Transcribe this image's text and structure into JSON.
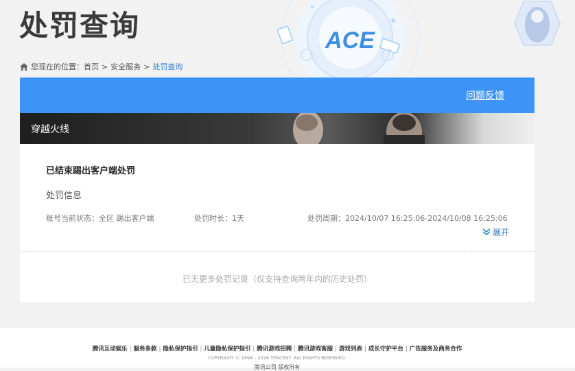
{
  "page": {
    "title": "处罚查询"
  },
  "breadcrumb": {
    "prefix": "您现在的位置：",
    "items": [
      "首页",
      "安全服务",
      "处罚查询"
    ],
    "separator": ">"
  },
  "header": {
    "feedback_label": "问题反馈"
  },
  "game": {
    "name": "穿越火线"
  },
  "record": {
    "title": "已结束踢出客户端处罚",
    "info_heading": "处罚信息",
    "status": "账号当前状态：全区 踢出客户端",
    "duration": "处罚时长：1天",
    "period": "处罚周期：2024/10/07 16:25:06-2024/10/08 16:25:06",
    "expand_label": "展开"
  },
  "no_more_text": "已无更多处罚记录（仅支持查询两年内的历史处罚）",
  "footer": {
    "links": [
      "腾讯互动娱乐",
      "服务条款",
      "隐私保护指引",
      "儿童隐私保护指引",
      "腾讯游戏招聘",
      "腾讯游戏客服",
      "游戏列表",
      "成长守护平台",
      "广告服务及商务合作"
    ],
    "copyright": "COPYRIGHT © 1998 – 2026 TENCENT. ALL RIGHTS RESERVED.",
    "cutoff_text": "腾讯公司 版权所有"
  },
  "colors": {
    "accent": "#3d94f6",
    "link": "#2f7fd3"
  }
}
